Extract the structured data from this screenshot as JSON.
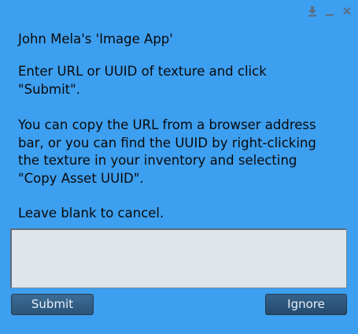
{
  "dialog": {
    "title": "John Mela's 'Image App'",
    "paragraph1": "Enter URL or UUID of texture and click\n\"Submit\".",
    "paragraph2": "You can copy the URL from a browser address\nbar, or you can find the UUID by right-clicking\nthe texture in your inventory and selecting\n\"Copy Asset UUID\".",
    "paragraph3": "Leave blank to cancel.",
    "input_value": "",
    "submit_label": "Submit",
    "ignore_label": "Ignore"
  },
  "controls": {
    "dock_icon": "dock-icon",
    "minimize_icon": "minimize-icon",
    "close_icon": "close-icon"
  },
  "colors": {
    "background": "#3d9ff0",
    "input_background": "#dfe5eb",
    "button": "#2f5d86"
  }
}
